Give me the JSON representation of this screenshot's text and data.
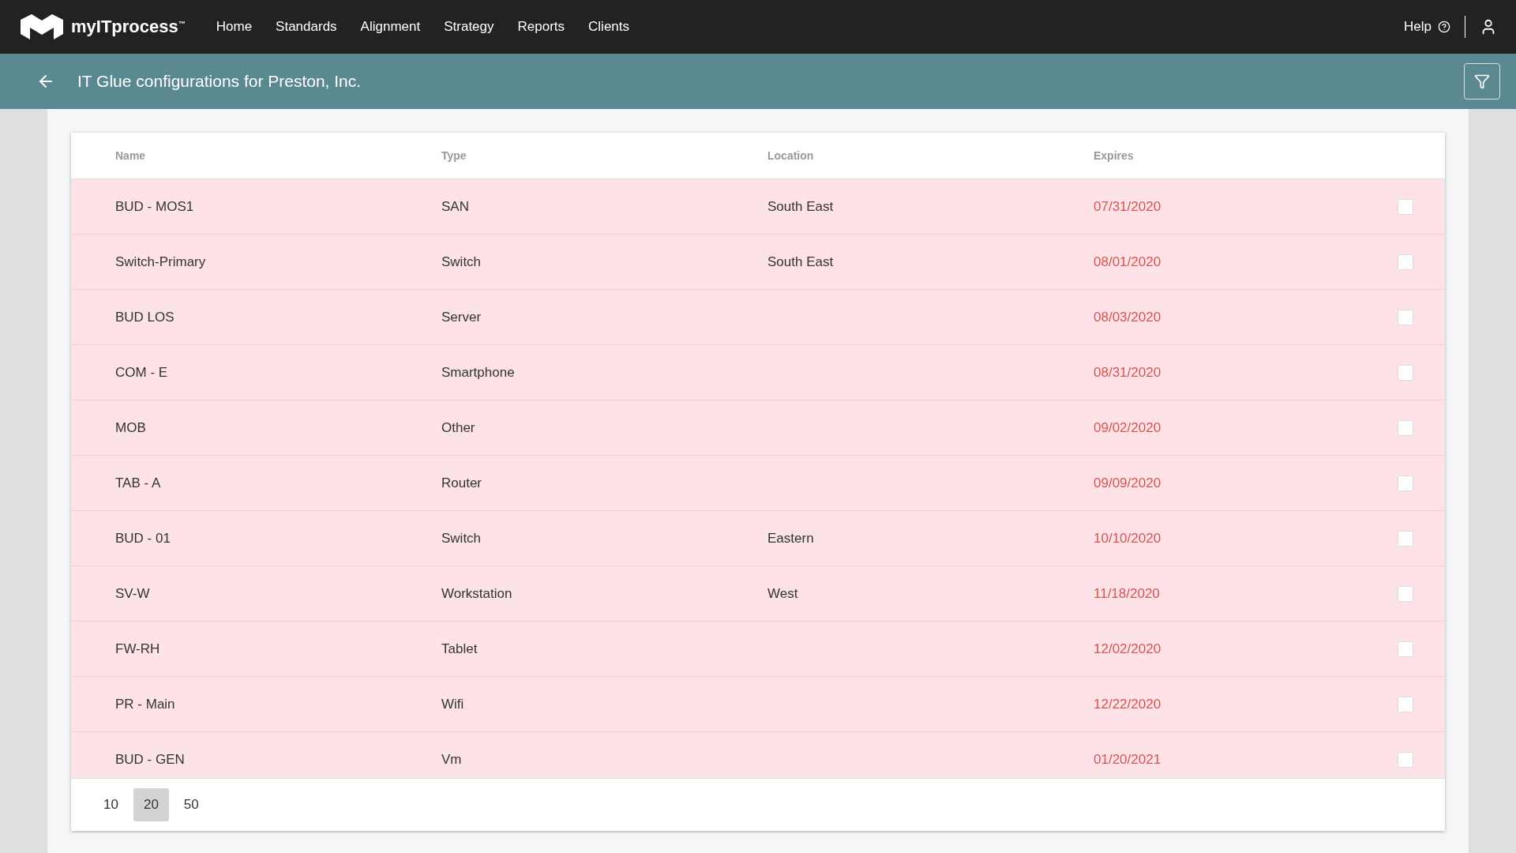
{
  "nav": {
    "brand": "myITprocess",
    "trademark": "™",
    "links": [
      "Home",
      "Standards",
      "Alignment",
      "Strategy",
      "Reports",
      "Clients"
    ],
    "help": "Help"
  },
  "header": {
    "title": "IT Glue configurations for Preston, Inc."
  },
  "table": {
    "columns": [
      "Name",
      "Type",
      "Location",
      "Expires"
    ],
    "rows": [
      {
        "name": "BUD - MOS1",
        "type": "SAN",
        "location": "South East",
        "expires": "07/31/2020",
        "expired": true,
        "checked": false
      },
      {
        "name": "Switch-Primary",
        "type": "Switch",
        "location": "South East",
        "expires": "08/01/2020",
        "expired": true,
        "checked": false
      },
      {
        "name": "BUD LOS",
        "type": "Server",
        "location": "",
        "expires": "08/03/2020",
        "expired": true,
        "checked": false
      },
      {
        "name": "COM - E",
        "type": "Smartphone",
        "location": "",
        "expires": "08/31/2020",
        "expired": true,
        "checked": false
      },
      {
        "name": "MOB",
        "type": "Other",
        "location": "",
        "expires": "09/02/2020",
        "expired": true,
        "checked": false
      },
      {
        "name": "TAB - A",
        "type": "Router",
        "location": "",
        "expires": "09/09/2020",
        "expired": true,
        "checked": false
      },
      {
        "name": "BUD - 01",
        "type": "Switch",
        "location": "Eastern",
        "expires": "10/10/2020",
        "expired": true,
        "checked": false
      },
      {
        "name": "SV-W",
        "type": "Workstation",
        "location": "West",
        "expires": "11/18/2020",
        "expired": true,
        "checked": false
      },
      {
        "name": "FW-RH",
        "type": "Tablet",
        "location": "",
        "expires": "12/02/2020",
        "expired": true,
        "checked": false
      },
      {
        "name": "PR - Main",
        "type": "Wifi",
        "location": "",
        "expires": "12/22/2020",
        "expired": true,
        "checked": false
      },
      {
        "name": "BUD - GEN",
        "type": "Vm",
        "location": "",
        "expires": "01/20/2021",
        "expired": true,
        "checked": false
      }
    ]
  },
  "page_sizes": [
    {
      "label": "10",
      "selected": false
    },
    {
      "label": "20",
      "selected": true
    },
    {
      "label": "50",
      "selected": false
    }
  ]
}
